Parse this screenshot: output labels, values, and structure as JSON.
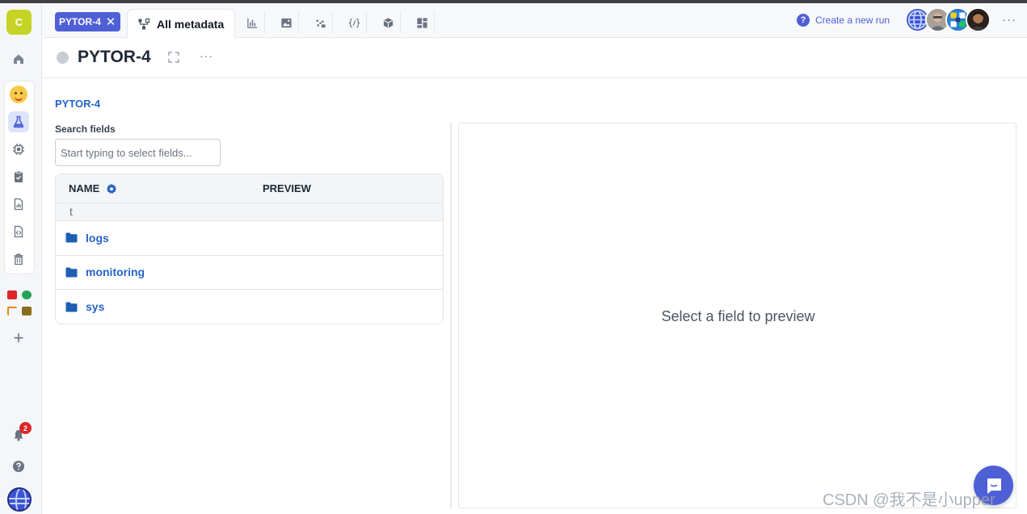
{
  "sidebar": {
    "org_initial": "C",
    "notification_count": "2",
    "items": [
      {
        "icon": "home-icon"
      },
      {
        "icon": "hugging-face-icon"
      },
      {
        "icon": "flask-icon",
        "active": true
      },
      {
        "icon": "chip-icon"
      },
      {
        "icon": "clipboard-icon"
      },
      {
        "icon": "report-icon"
      },
      {
        "icon": "code-file-icon"
      },
      {
        "icon": "trash-icon"
      }
    ],
    "colors": {
      "org_badge": "#c5d424",
      "active": "#4f5fd6",
      "badge": "#dc2626"
    }
  },
  "tabs": {
    "run_chip": "PYTOR-4",
    "active_tab": "All metadata",
    "icon_tabs": [
      "charts-icon",
      "images-icon",
      "scatter-icon",
      "source-code-icon",
      "artifacts-icon",
      "dashboard-icon"
    ]
  },
  "topbar": {
    "create_run": "Create a new run",
    "more": "···"
  },
  "header": {
    "run_title": "PYTOR-4",
    "more": "···"
  },
  "main": {
    "breadcrumb": "PYTOR-4",
    "search_label": "Search fields",
    "search_placeholder": "Start typing to select fields...",
    "columns": [
      "NAME",
      "PREVIEW"
    ],
    "up_symbol": "t",
    "rows": [
      "logs",
      "monitoring",
      "sys"
    ],
    "preview_empty": "Select a field to preview"
  },
  "watermark": "CSDN @我不是小upper"
}
